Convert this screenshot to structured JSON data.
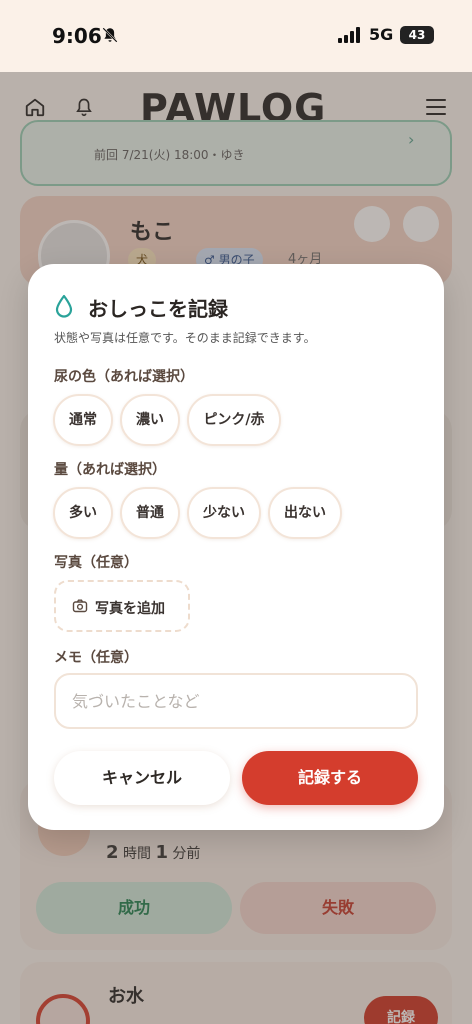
{
  "status_bar": {
    "time": "9:06",
    "network": "5G",
    "battery": "43"
  },
  "app": {
    "logo": "PAWLOG",
    "last_record": "前回 7/21(火) 18:00・ゆき",
    "pet": {
      "name": "もこ",
      "species": "犬",
      "sex": "♂ 男の子",
      "age": "4ヶ月"
    },
    "timer": {
      "hours": "2",
      "hours_unit": "時間",
      "minutes": "1",
      "minutes_unit": "分前"
    },
    "success_label": "成功",
    "fail_label": "失敗",
    "water_title": "お水",
    "water_record": "記録"
  },
  "modal": {
    "title": "おしっこを記録",
    "subtitle": "状態や写真は任意です。そのまま記録できます。",
    "color_label": "尿の色（あれば選択）",
    "color_options": [
      "通常",
      "濃い",
      "ピンク/赤"
    ],
    "amount_label": "量（あれば選択）",
    "amount_options": [
      "多い",
      "普通",
      "少ない",
      "出ない"
    ],
    "photo_label": "写真（任意）",
    "photo_button": "写真を追加",
    "memo_label": "メモ（任意）",
    "memo_placeholder": "気づいたことなど",
    "cancel": "キャンセル",
    "submit": "記録する"
  },
  "colors": {
    "accent": "#d43d2d",
    "teal": "#2aa39a",
    "chip_border": "#f3e4d8"
  }
}
